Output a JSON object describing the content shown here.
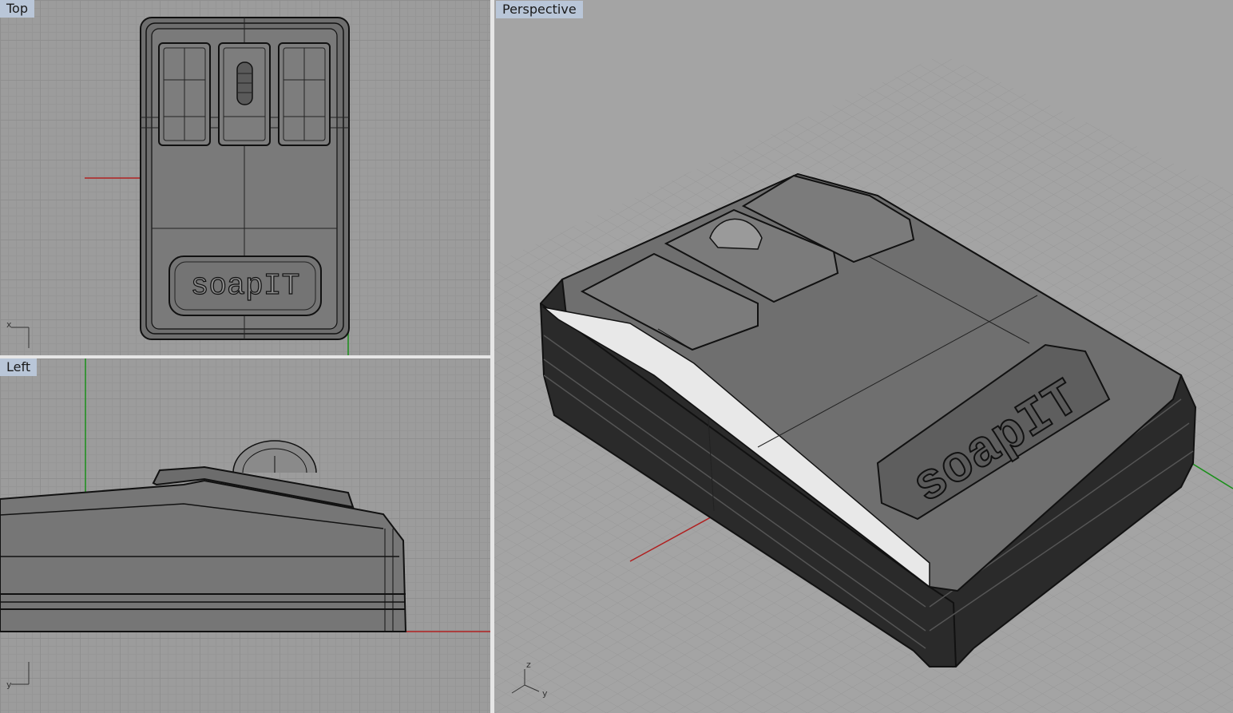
{
  "viewports": {
    "top": {
      "title": "Top",
      "axis_x": "x",
      "axis_y": "y"
    },
    "left": {
      "title": "Left",
      "axis_y": "y"
    },
    "perspective": {
      "title": "Perspective",
      "axis_z": "z",
      "axis_y": "y"
    }
  },
  "model": {
    "logo_text": "soapIT"
  },
  "colors": {
    "viewport_bg": "#9c9c9c",
    "title_bg": "#b9c6d8",
    "x_axis": "#b02020",
    "y_axis": "#1a8f1a",
    "edge": "#111111"
  }
}
